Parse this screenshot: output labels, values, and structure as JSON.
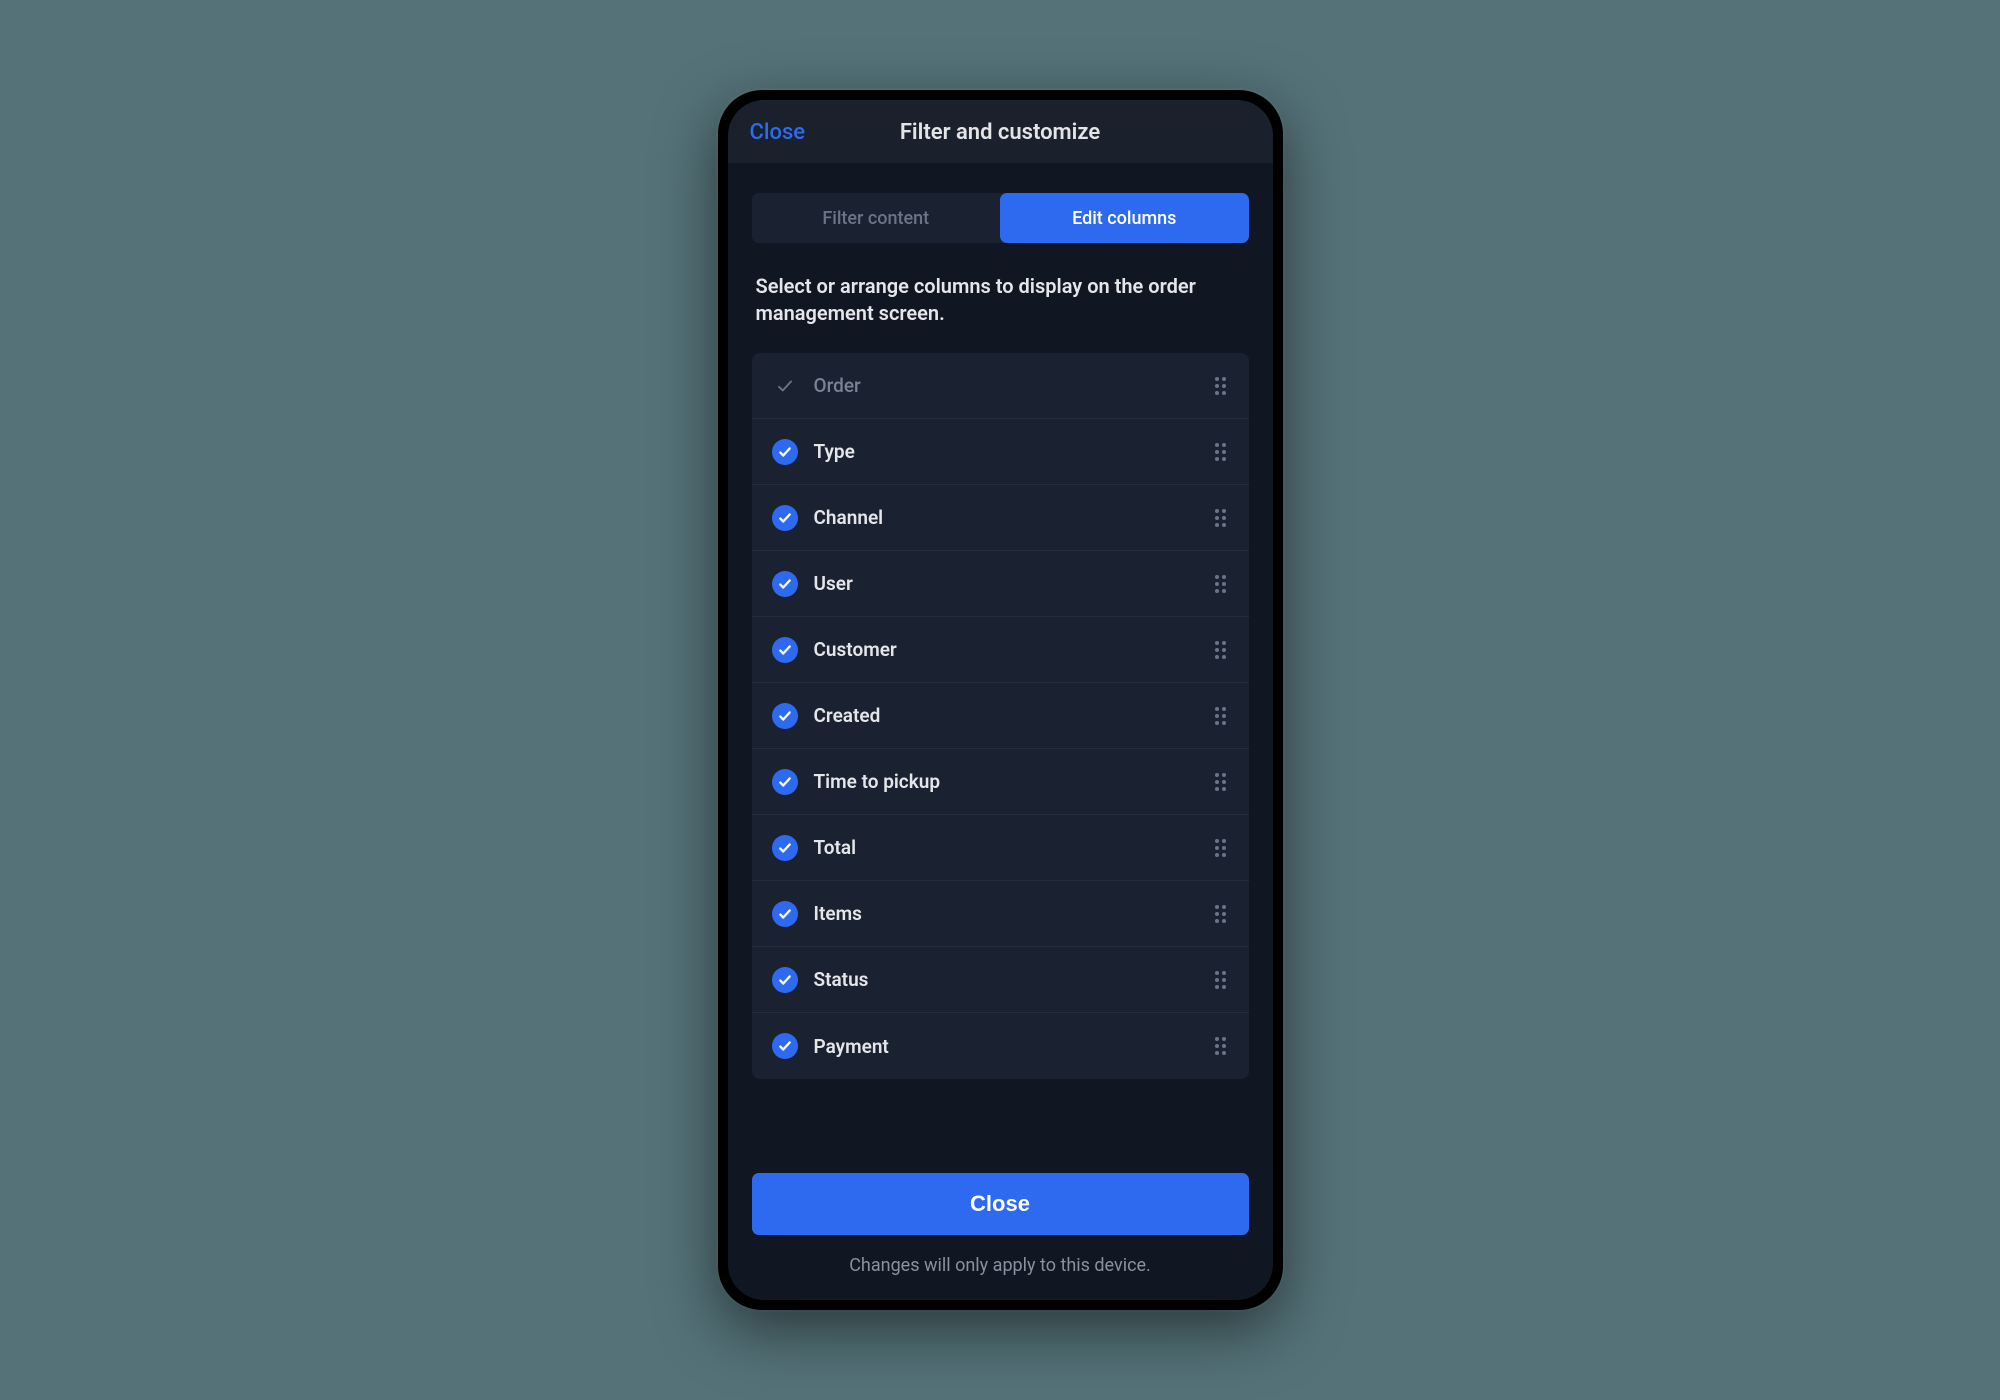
{
  "header": {
    "close_label": "Close",
    "title": "Filter and customize"
  },
  "tabs": {
    "filter_content": "Filter content",
    "edit_columns": "Edit columns"
  },
  "instructions": "Select or arrange columns to display on the order management screen.",
  "columns": [
    {
      "label": "Order",
      "locked": true,
      "checked": true
    },
    {
      "label": "Type",
      "locked": false,
      "checked": true
    },
    {
      "label": "Channel",
      "locked": false,
      "checked": true
    },
    {
      "label": "User",
      "locked": false,
      "checked": true
    },
    {
      "label": "Customer",
      "locked": false,
      "checked": true
    },
    {
      "label": "Created",
      "locked": false,
      "checked": true
    },
    {
      "label": "Time to pickup",
      "locked": false,
      "checked": true
    },
    {
      "label": "Total",
      "locked": false,
      "checked": true
    },
    {
      "label": "Items",
      "locked": false,
      "checked": true
    },
    {
      "label": "Status",
      "locked": false,
      "checked": true
    },
    {
      "label": "Payment",
      "locked": false,
      "checked": true
    }
  ],
  "footer": {
    "close_button": "Close",
    "note": "Changes will only apply to this device."
  },
  "colors": {
    "accent": "#2e6af0",
    "bg": "#111722",
    "panel": "#1a2130"
  }
}
